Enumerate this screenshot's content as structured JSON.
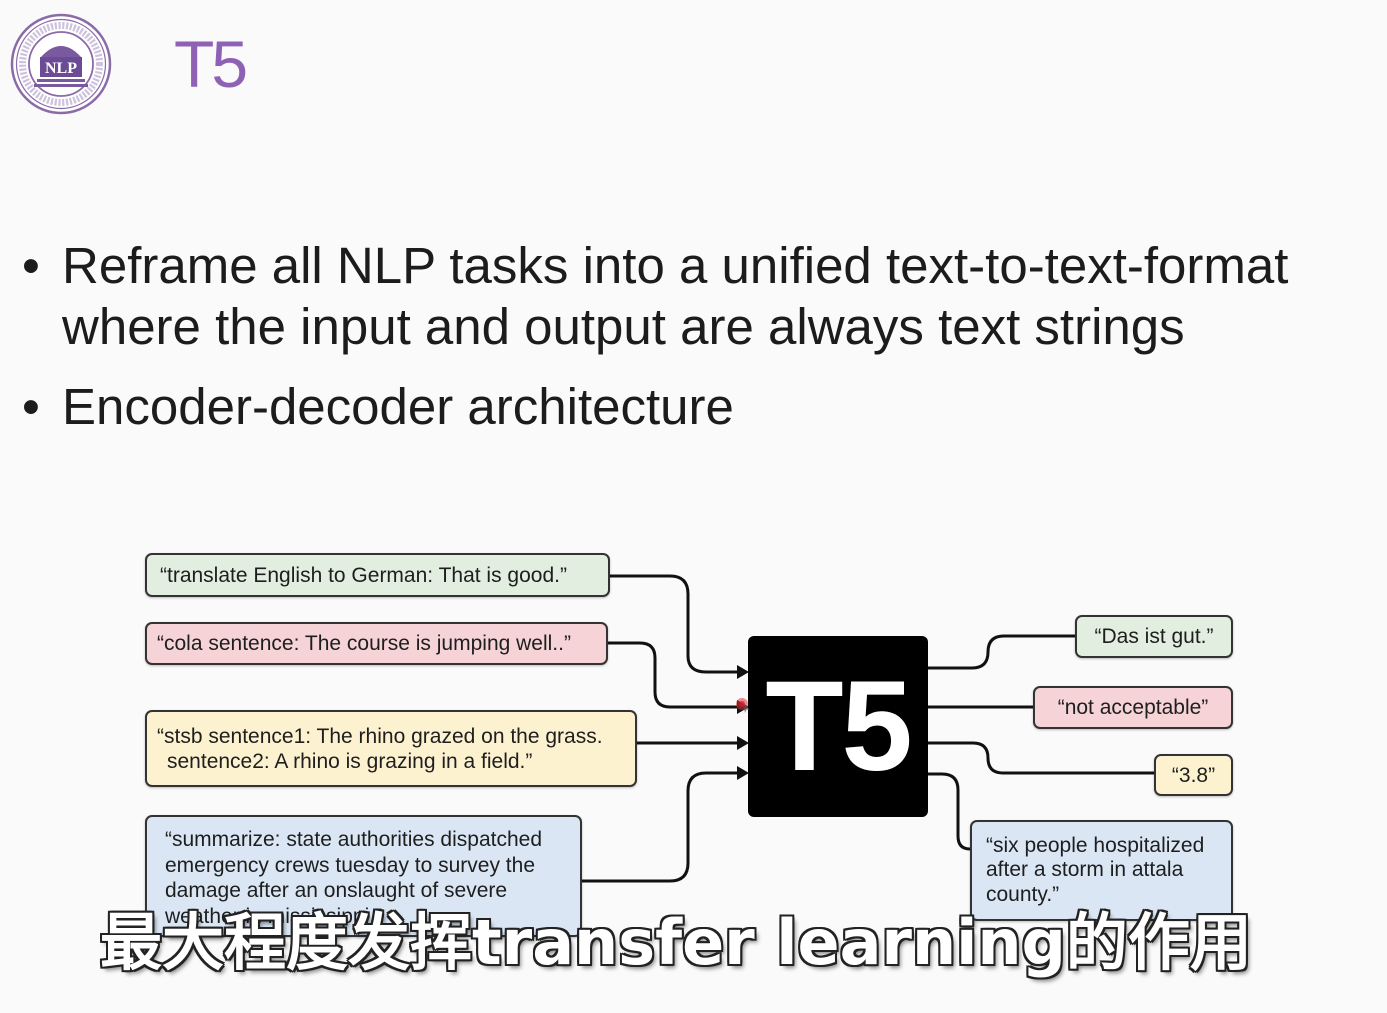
{
  "logo": {
    "text": "NLP"
  },
  "slide": {
    "title": "T5",
    "bullet_marker": "•",
    "bullets": [
      {
        "lines": [
          "Reframe all NLP tasks into a unified text-to-text-format",
          "where the input and output are always text strings"
        ]
      },
      {
        "lines": [
          "Encoder-decoder architecture"
        ]
      }
    ]
  },
  "diagram": {
    "model_label": "T5",
    "inputs": [
      {
        "color": "#e2eedf",
        "lines": [
          "“translate English to German:  That is good.”"
        ]
      },
      {
        "color": "#f5d3d6",
        "lines": [
          "“cola sentence: The course is jumping well..”"
        ]
      },
      {
        "color": "#fdf2d0",
        "lines": [
          "“stsb sentence1: The rhino grazed on the grass.",
          "sentence2: A rhino is grazing in a field.”"
        ]
      },
      {
        "color": "#dae6f4",
        "lines": [
          "“summarize: state authorities dispatched",
          "emergency crews tuesday to survey the",
          "damage after an onslaught of severe",
          "weather in mississippi.”"
        ]
      }
    ],
    "outputs": [
      {
        "color": "#e2eedf",
        "lines": [
          "“Das ist gut.”"
        ]
      },
      {
        "color": "#f5d3d6",
        "lines": [
          "“not acceptable”"
        ]
      },
      {
        "color": "#fdf2d0",
        "lines": [
          "“3.8”"
        ]
      },
      {
        "color": "#dae6f4",
        "lines": [
          "“six people hospitalized",
          "after a storm in attala",
          "county.”"
        ]
      }
    ]
  },
  "subtitle": "最大程度发挥transfer learning的作用",
  "colors": {
    "title": "#8f61b4",
    "logo_purple": "#8b6aa8",
    "model_box": "#000000",
    "background": "#fafafa"
  }
}
